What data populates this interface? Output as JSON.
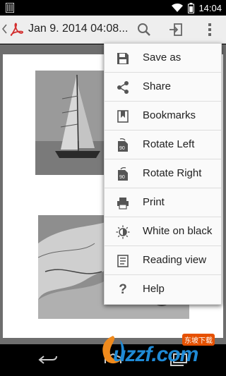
{
  "status_bar": {
    "time": "14:04",
    "icons": [
      "notification-icon",
      "wifi-icon",
      "battery-icon"
    ]
  },
  "action_bar": {
    "title": "Jan 9. 2014 04:08...",
    "icons": [
      "back-chevron-icon",
      "pdf-icon",
      "search-icon",
      "exit-icon",
      "overflow-icon"
    ]
  },
  "menu": {
    "items": [
      {
        "label": "Save as",
        "icon": "save-icon"
      },
      {
        "label": "Share",
        "icon": "share-icon"
      },
      {
        "label": "Bookmarks",
        "icon": "bookmark-icon"
      },
      {
        "label": "Rotate Left",
        "icon": "rotate-left-icon"
      },
      {
        "label": "Rotate Right",
        "icon": "rotate-right-icon"
      },
      {
        "label": "Print",
        "icon": "print-icon"
      },
      {
        "label": "White on black",
        "icon": "night-mode-icon"
      },
      {
        "label": "Reading view",
        "icon": "reading-view-icon"
      },
      {
        "label": "Help",
        "icon": "help-icon"
      }
    ]
  },
  "nav_bar": {
    "icons": [
      "back-icon",
      "home-icon",
      "recents-icon"
    ]
  },
  "watermark": {
    "text": "uzzf.com",
    "badge": "东坡下载"
  },
  "colors": {
    "pdf_red": "#d32f2f",
    "menu_icon": "#555555",
    "action_icon": "#666666",
    "watermark_blue": "#1f8ad6"
  }
}
